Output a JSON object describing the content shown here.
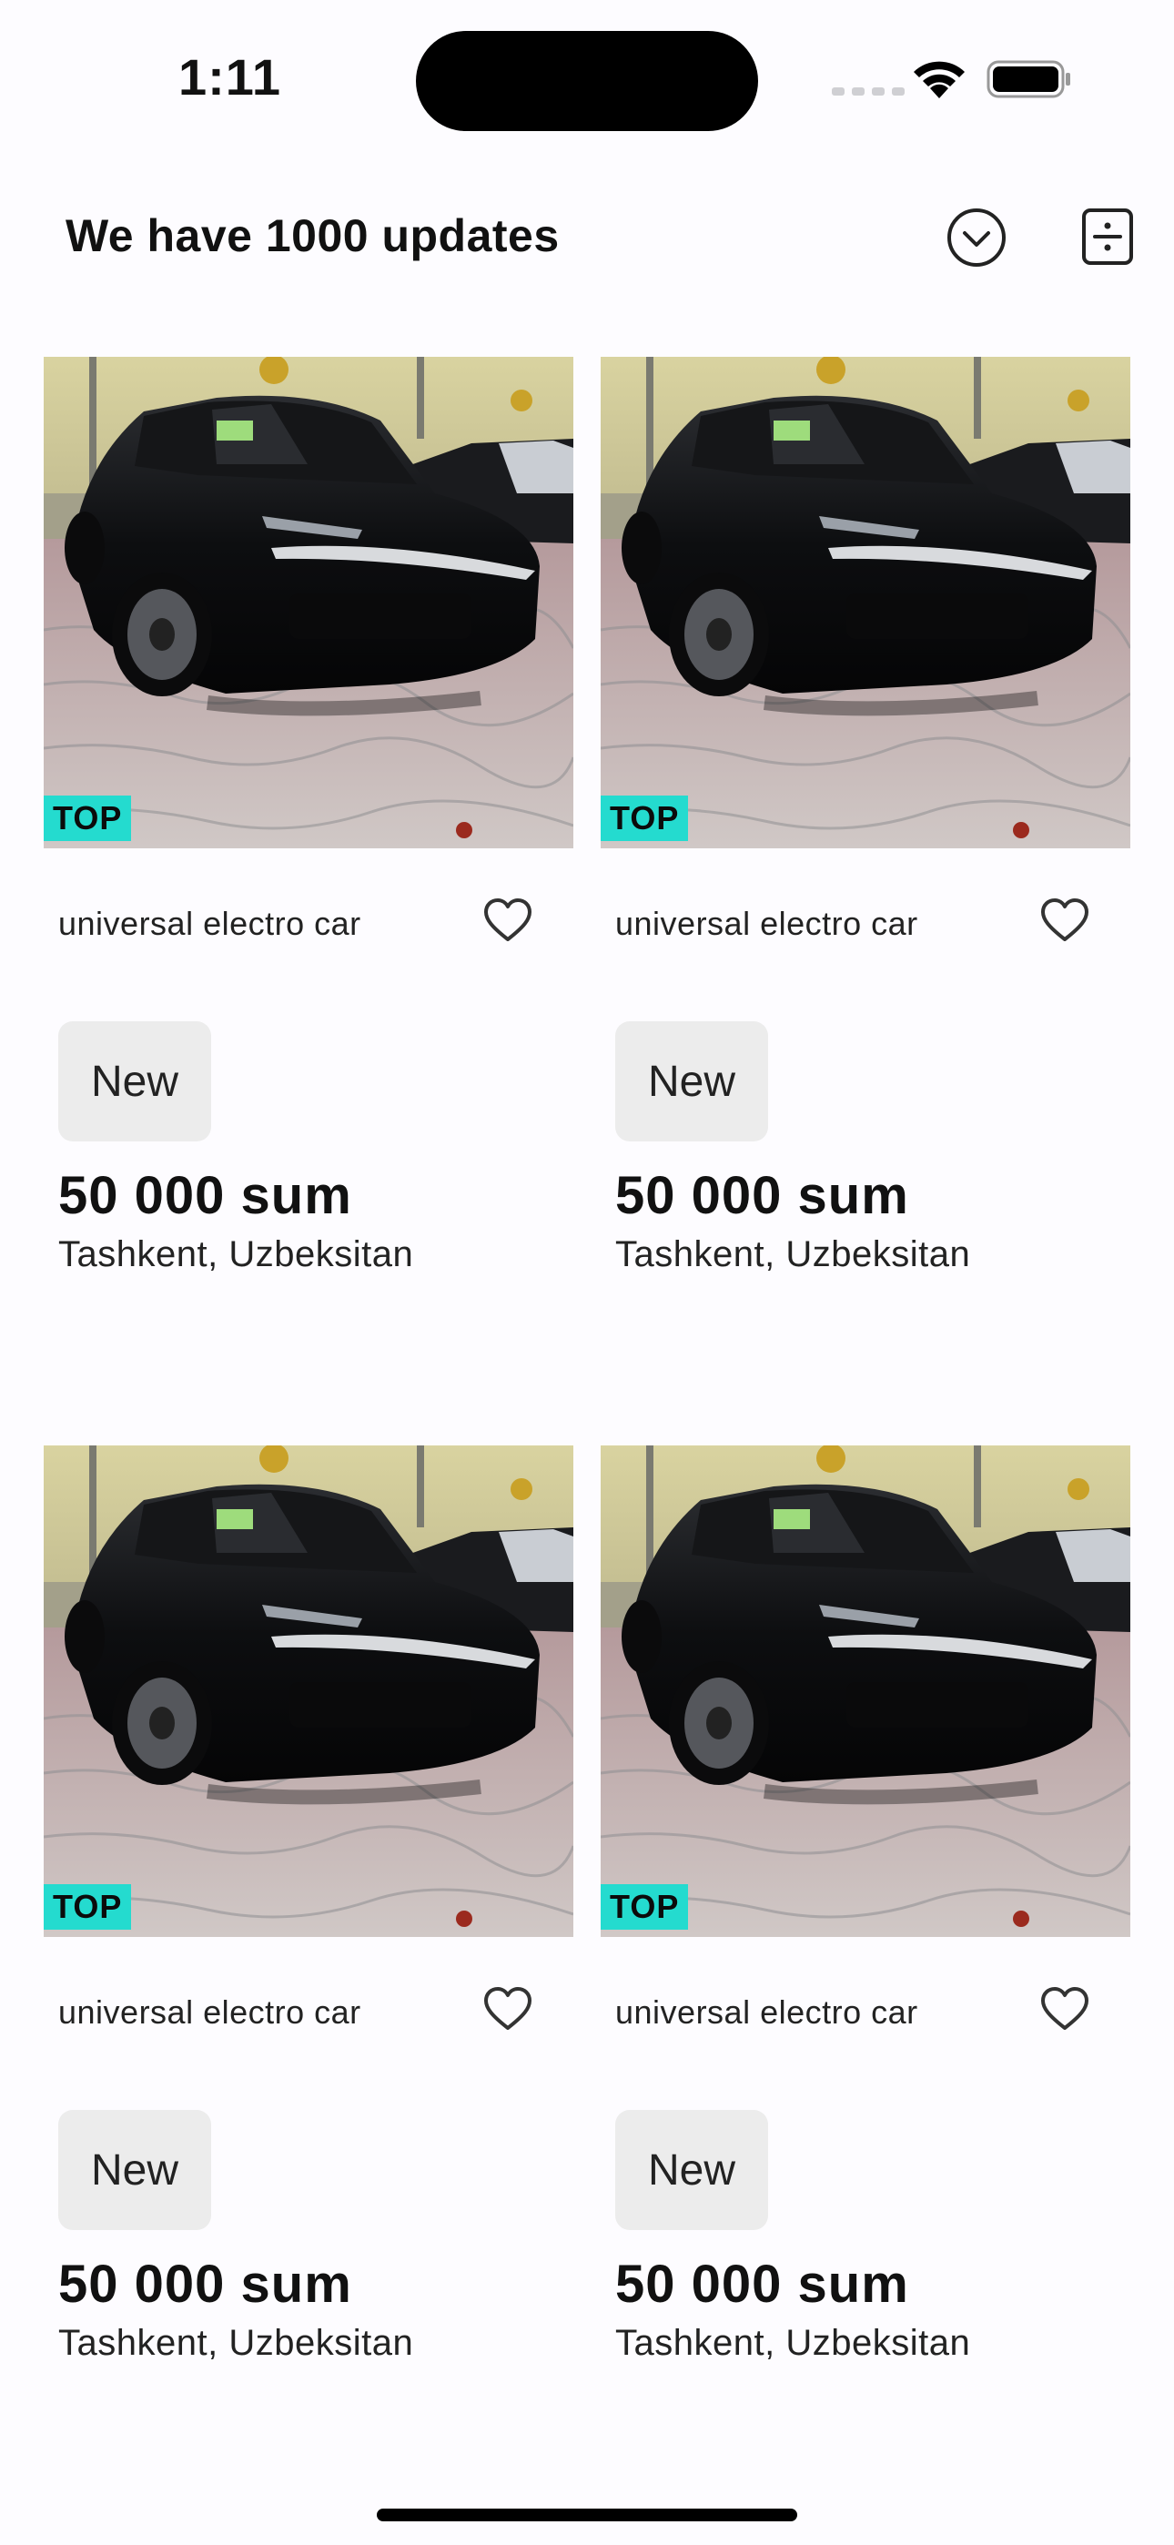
{
  "status_bar": {
    "time": "1:11"
  },
  "header": {
    "title": "We have 1000 updates",
    "sort_icon": "chevron-down-circle-icon",
    "layout_icon": "divide-square-icon"
  },
  "listings": [
    {
      "badge": "TOP",
      "title": "universal electro car",
      "condition": "New",
      "price": "50 000 sum",
      "location": "Tashkent, Uzbeksitan"
    },
    {
      "badge": "TOP",
      "title": "universal electro car",
      "condition": "New",
      "price": "50 000 sum",
      "location": "Tashkent, Uzbeksitan"
    },
    {
      "badge": "TOP",
      "title": "universal electro car",
      "condition": "New",
      "price": "50 000 sum",
      "location": "Tashkent, Uzbeksitan"
    },
    {
      "badge": "TOP",
      "title": "universal electro car",
      "condition": "New",
      "price": "50 000 sum",
      "location": "Tashkent, Uzbeksitan"
    }
  ],
  "colors": {
    "top_badge": "#24dbcf",
    "condition_badge": "#ececec",
    "background": "#fdfcff"
  }
}
